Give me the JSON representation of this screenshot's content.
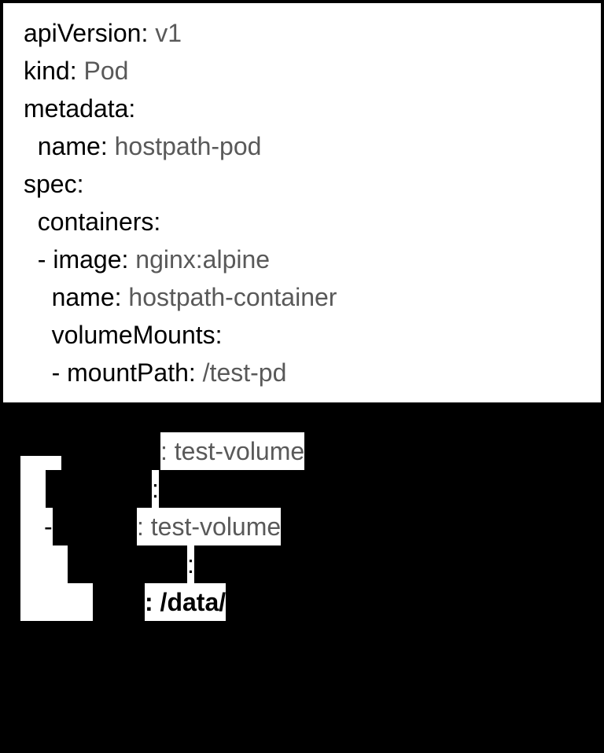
{
  "code": {
    "l1_key": "apiVersion",
    "l1_val": "v1",
    "l2_key": "kind",
    "l2_val": "Pod",
    "l3_key": "metadata",
    "l4_key": "name",
    "l4_val": "hostpath-pod",
    "l5_key": "spec",
    "l6_key": "containers",
    "l7_key": "image",
    "l7_val": "nginx:alpine",
    "l8_key": "name",
    "l8_val": "hostpath-container",
    "l9_key": "volumeMounts",
    "l10_key": "mountPath",
    "l10_val": "/test-pd"
  },
  "below": {
    "l11_val_frag": ": test-volume",
    "l12_colon": ":",
    "l13_dash": "- ",
    "l13_val_frag": ": test-volume",
    "l14_colon": ":",
    "l15_val_frag": ": /data/"
  }
}
